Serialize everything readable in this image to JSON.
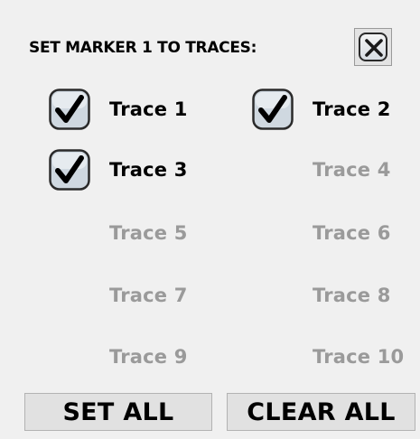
{
  "dialog": {
    "title": "SET MARKER 1 TO TRACES:",
    "close_icon": "close-x-icon"
  },
  "traces": [
    {
      "label": "Trace 1",
      "checked": true
    },
    {
      "label": "Trace 2",
      "checked": true
    },
    {
      "label": "Trace 3",
      "checked": true
    },
    {
      "label": "Trace 4",
      "checked": false
    },
    {
      "label": "Trace 5",
      "checked": false
    },
    {
      "label": "Trace 6",
      "checked": false
    },
    {
      "label": "Trace 7",
      "checked": false
    },
    {
      "label": "Trace 8",
      "checked": false
    },
    {
      "label": "Trace 9",
      "checked": false
    },
    {
      "label": "Trace 10",
      "checked": false
    }
  ],
  "buttons": {
    "set_all": "SET ALL",
    "clear_all": "CLEAR ALL"
  },
  "colors": {
    "background": "#f0f0f0",
    "checked_text": "#000000",
    "unchecked_text": "#9a9a9a",
    "button_face": "#e1e1e1"
  }
}
